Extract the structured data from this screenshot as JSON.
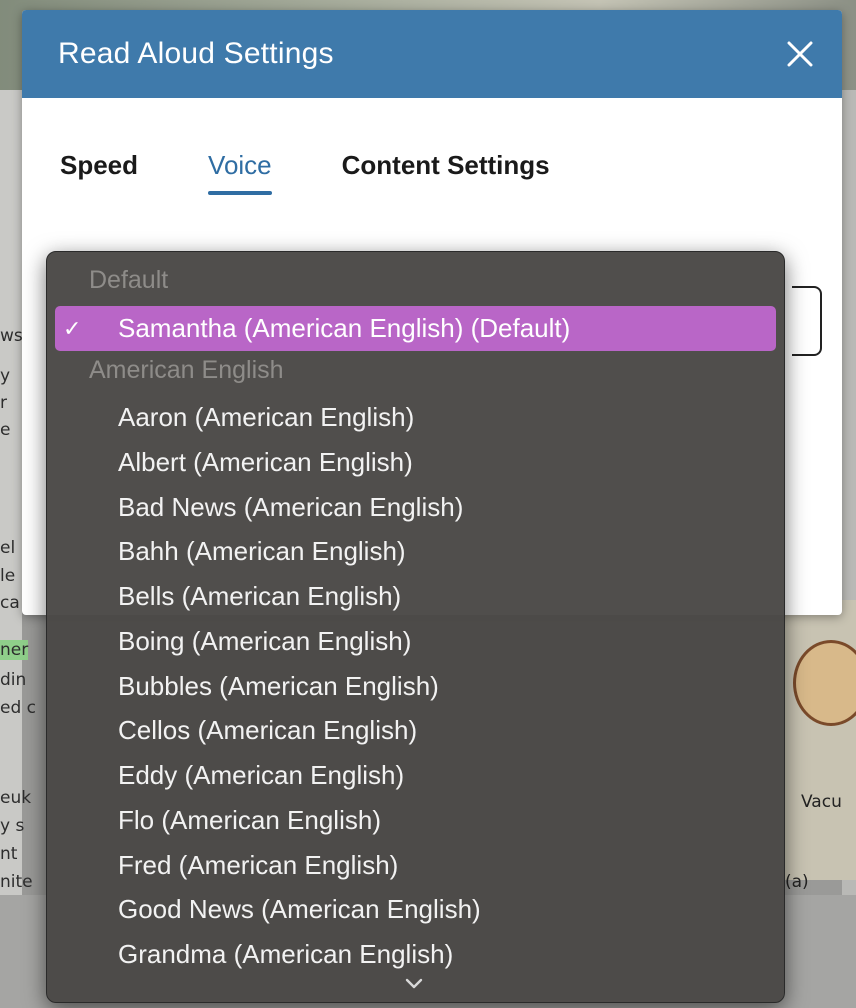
{
  "dialog": {
    "title": "Read Aloud Settings",
    "close_icon": "close-icon",
    "header_color": "#3f7aab",
    "tabs": [
      {
        "label": "Speed",
        "active": false
      },
      {
        "label": "Voice",
        "active": true
      },
      {
        "label": "Content Settings",
        "active": false
      }
    ]
  },
  "voice_menu": {
    "selected_color": "#b966c7",
    "groups": [
      {
        "header": "Default"
      },
      {
        "header": "American English"
      }
    ],
    "selected": {
      "label": "Samantha (American English) (Default)",
      "checked": true
    },
    "options": [
      "Aaron (American English)",
      "Albert (American English)",
      "Bad News (American English)",
      "Bahh (American English)",
      "Bells (American English)",
      "Boing (American English)",
      "Bubbles (American English)",
      "Cellos (American English)",
      "Eddy (American English)",
      "Flo (American English)",
      "Fred (American English)",
      "Good News (American English)",
      "Grandma (American English)"
    ],
    "scroll_icon": "chevron-down-icon"
  },
  "background": {
    "left_fragments": [
      "ws",
      "y",
      "r",
      "e",
      "el",
      "le",
      "ca",
      "ner",
      "din",
      "ed c",
      "euk",
      "y s",
      "nt",
      "nite"
    ],
    "figure_labels": [
      "Vacu",
      "(a)"
    ]
  }
}
